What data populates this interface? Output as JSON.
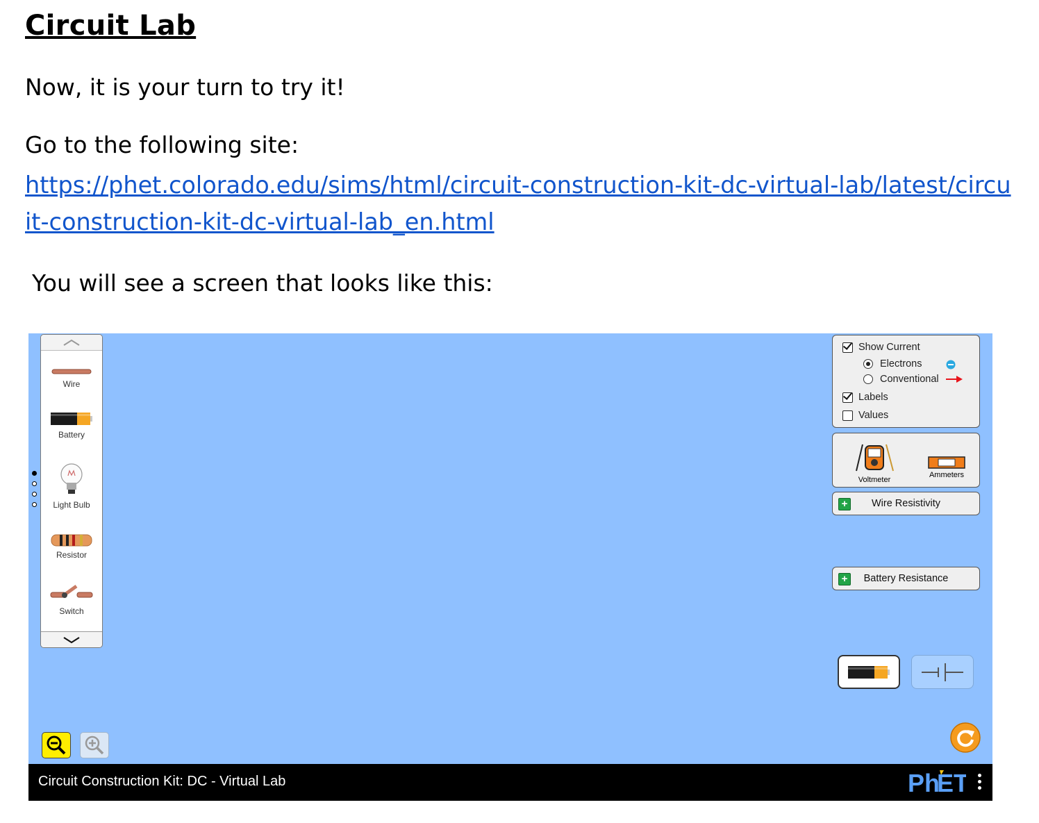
{
  "doc": {
    "title": "Circuit Lab",
    "intro": "Now, it is your turn to try it!",
    "instruction": "Go to the following site:",
    "link": "https://phet.colorado.edu/sims/html/circuit-construction-kit-dc-virtual-lab/latest/circuit-construction-kit-dc-virtual-lab_en.html",
    "see_screen": "You will see a screen that looks like this:"
  },
  "sim": {
    "background_color": "#8fc0ff",
    "toolbox": {
      "items": [
        {
          "label": "Wire",
          "icon": "wire-icon"
        },
        {
          "label": "Battery",
          "icon": "battery-icon"
        },
        {
          "label": "Light Bulb",
          "icon": "light-bulb-icon"
        },
        {
          "label": "Resistor",
          "icon": "resistor-icon"
        },
        {
          "label": "Switch",
          "icon": "switch-icon"
        }
      ],
      "page_count": 4,
      "current_page": 1
    },
    "display_options": {
      "show_current": {
        "label": "Show Current",
        "checked": true
      },
      "electrons": {
        "label": "Electrons",
        "selected": true
      },
      "conventional": {
        "label": "Conventional",
        "selected": false
      },
      "labels": {
        "label": "Labels",
        "checked": true
      },
      "values": {
        "label": "Values",
        "checked": false
      }
    },
    "sensors": {
      "voltmeter": "Voltmeter",
      "ammeters": "Ammeters"
    },
    "wire_resistivity": "Wire Resistivity",
    "battery_resistance": "Battery Resistance",
    "bottom_bar": {
      "title": "Circuit Construction Kit: DC - Virtual Lab",
      "logo": "PhET"
    },
    "colors": {
      "accordion_plus": "#22a447",
      "reset_button": "#f59b1e",
      "zoom_out_active": "#ffee00",
      "link": "#1155cc"
    }
  }
}
